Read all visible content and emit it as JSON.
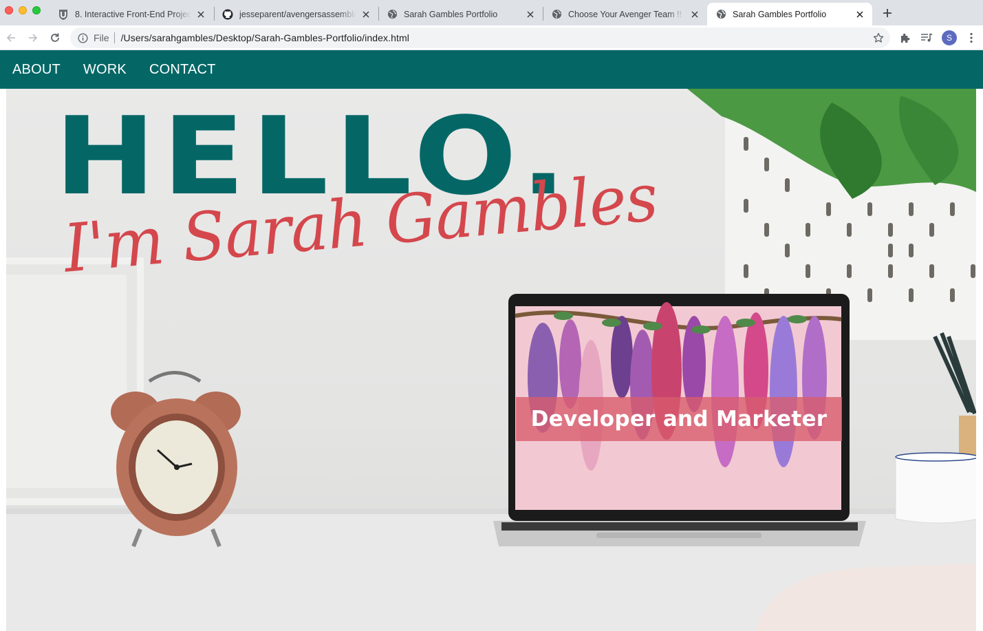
{
  "browser": {
    "tabs": [
      {
        "title": "8. Interactive Front-End Projec",
        "favicon": "u-shield-icon",
        "active": false
      },
      {
        "title": "jesseparent/avengersassemble",
        "favicon": "github-icon",
        "active": false
      },
      {
        "title": "Sarah Gambles Portfolio",
        "favicon": "globe-icon",
        "active": false
      },
      {
        "title": "Choose Your Avenger Team !!",
        "favicon": "globe-icon",
        "active": false
      },
      {
        "title": "Sarah Gambles Portfolio",
        "favicon": "globe-icon",
        "active": true
      }
    ],
    "address": {
      "scheme_label": "File",
      "url": "/Users/sarahgambles/Desktop/Sarah-Gambles-Portfolio/index.html"
    },
    "profile_initial": "S"
  },
  "site": {
    "nav": [
      {
        "label": "ABOUT"
      },
      {
        "label": "WORK"
      },
      {
        "label": "CONTACT"
      }
    ],
    "hero": {
      "greeting": "HELLO.",
      "name_line": "I'm Sarah Gambles",
      "tagline": "Developer and Marketer"
    },
    "colors": {
      "nav_bg": "#046766",
      "hello_color": "#046766",
      "name_color": "#d4474c",
      "tagline_band": "#d85c6c"
    }
  }
}
